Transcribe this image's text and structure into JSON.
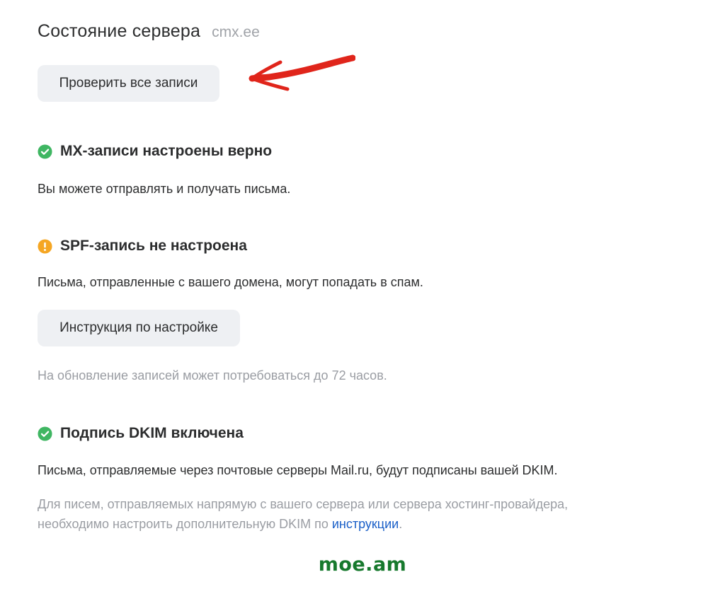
{
  "header": {
    "title": "Состояние сервера",
    "domain": "cmx.ee"
  },
  "buttons": {
    "check_all": "Проверить все записи",
    "setup_guide": "Инструкция по настройке"
  },
  "annotation": {
    "arrow_color": "#e0251b",
    "arrow_icon": "red-hand-drawn-arrow-icon"
  },
  "mx": {
    "status": "MX-записи настроены верно",
    "icon": "check-circle-icon",
    "color": "#3fb662",
    "description": "Вы можете отправлять и получать письма."
  },
  "spf": {
    "status": "SPF-запись не настроена",
    "icon": "warning-circle-icon",
    "color": "#f5a623",
    "description": "Письма, отправленные с вашего домена, могут попадать в спам.",
    "note": "На обновление записей может потребоваться до 72 часов."
  },
  "dkim": {
    "status": "Подпись DKIM включена",
    "icon": "check-circle-icon",
    "color": "#3fb662",
    "description": "Письма, отправляемые через почтовые серверы Mail.ru, будут подписаны вашей DKIM.",
    "note_line1": "Для писем, отправляемых напрямую с вашего сервера или сервера хостинг-провайдера,",
    "note_line2": "необходимо настроить дополнительную DKIM по",
    "note_link": "инструкции",
    "note_end": ".",
    "link_color": "#1a5fc8"
  },
  "watermark": {
    "text": "moe.am",
    "color": "#17792d"
  }
}
